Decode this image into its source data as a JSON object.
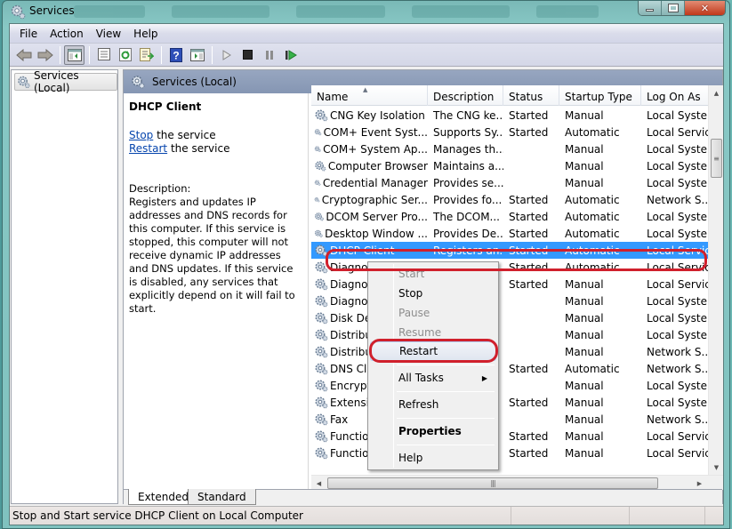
{
  "window": {
    "title": "Services",
    "buttons": {
      "minimize": "minimize",
      "maximize": "maximize",
      "close": "close"
    }
  },
  "menubar": {
    "items": [
      "File",
      "Action",
      "View",
      "Help"
    ]
  },
  "toolbar": {
    "buttons": [
      {
        "name": "back",
        "icon": "back-arrow-icon"
      },
      {
        "name": "forward",
        "icon": "forward-arrow-icon"
      },
      {
        "name": "show-hide-console-tree",
        "icon": "console-tree-icon"
      },
      {
        "name": "properties",
        "icon": "properties-icon"
      },
      {
        "name": "refresh",
        "icon": "refresh-icon"
      },
      {
        "name": "export-list",
        "icon": "export-icon"
      },
      {
        "name": "help",
        "icon": "help-icon"
      },
      {
        "name": "show-action-pane",
        "icon": "action-pane-icon"
      },
      {
        "name": "start-service",
        "icon": "play-icon"
      },
      {
        "name": "stop-service",
        "icon": "stop-icon"
      },
      {
        "name": "pause-service",
        "icon": "pause-icon"
      },
      {
        "name": "restart-service",
        "icon": "restart-icon"
      }
    ]
  },
  "tree": {
    "items": [
      {
        "label": "Services (Local)",
        "icon": "gear-icon",
        "selected": true
      }
    ]
  },
  "content": {
    "header_title": "Services (Local)",
    "details": {
      "service_name": "DHCP Client",
      "stop_link": "Stop",
      "stop_suffix": " the service",
      "restart_link": "Restart",
      "restart_suffix": " the service",
      "description_label": "Description:",
      "description": "Registers and updates IP addresses and DNS records for this computer. If this service is stopped, this computer will not receive dynamic IP addresses and DNS updates. If this service is disabled, any services that explicitly depend on it will fail to start."
    },
    "columns": [
      "Name",
      "Description",
      "Status",
      "Startup Type",
      "Log On As"
    ],
    "sort_column": "Name",
    "rows": [
      {
        "name": "CNG Key Isolation",
        "description": "The CNG ke...",
        "status": "Started",
        "startup": "Manual",
        "logon": "Local Syste..."
      },
      {
        "name": "COM+ Event Syst...",
        "description": "Supports Sy...",
        "status": "Started",
        "startup": "Automatic",
        "logon": "Local Service"
      },
      {
        "name": "COM+ System Ap...",
        "description": "Manages th...",
        "status": "",
        "startup": "Manual",
        "logon": "Local Syste..."
      },
      {
        "name": "Computer Browser",
        "description": "Maintains a...",
        "status": "",
        "startup": "Manual",
        "logon": "Local Syste..."
      },
      {
        "name": "Credential Manager",
        "description": "Provides se...",
        "status": "",
        "startup": "Manual",
        "logon": "Local Syste..."
      },
      {
        "name": "Cryptographic Ser...",
        "description": "Provides fo...",
        "status": "Started",
        "startup": "Automatic",
        "logon": "Network S..."
      },
      {
        "name": "DCOM Server Pro...",
        "description": "The DCOM...",
        "status": "Started",
        "startup": "Automatic",
        "logon": "Local Syste..."
      },
      {
        "name": "Desktop Window ...",
        "description": "Provides De...",
        "status": "Started",
        "startup": "Automatic",
        "logon": "Local Syste..."
      },
      {
        "name": "DHCP Client",
        "description": "Registers an...",
        "status": "Started",
        "startup": "Automatic",
        "logon": "Local Service",
        "selected": true
      },
      {
        "name": "Diagnos",
        "description": "",
        "status": "Started",
        "startup": "Automatic",
        "logon": "Local Service"
      },
      {
        "name": "Diagnos",
        "description": "",
        "status": "Started",
        "startup": "Manual",
        "logon": "Local Service"
      },
      {
        "name": "Diagnos",
        "description": "",
        "status": "",
        "startup": "Manual",
        "logon": "Local Syste..."
      },
      {
        "name": "Disk Def",
        "description": "",
        "status": "",
        "startup": "Manual",
        "logon": "Local Syste..."
      },
      {
        "name": "Distribut",
        "description": "",
        "status": "",
        "startup": "Manual",
        "logon": "Local Syste..."
      },
      {
        "name": "Distribut",
        "description": "",
        "status": "",
        "startup": "Manual",
        "logon": "Network S..."
      },
      {
        "name": "DNS Clie",
        "description": "",
        "status": "Started",
        "startup": "Automatic",
        "logon": "Network S..."
      },
      {
        "name": "Encrypti",
        "description": "",
        "status": "",
        "startup": "Manual",
        "logon": "Local Syste..."
      },
      {
        "name": "Extensib",
        "description": "",
        "status": "Started",
        "startup": "Manual",
        "logon": "Local Syste..."
      },
      {
        "name": "Fax",
        "description": "",
        "status": "",
        "startup": "Manual",
        "logon": "Network S..."
      },
      {
        "name": "Function",
        "description": "",
        "status": "Started",
        "startup": "Manual",
        "logon": "Local Service"
      },
      {
        "name": "Function",
        "description": "",
        "status": "Started",
        "startup": "Manual",
        "logon": "Local Service"
      }
    ],
    "tabs": [
      "Extended",
      "Standard"
    ],
    "active_tab": "Extended"
  },
  "context_menu": {
    "items": [
      {
        "label": "Start",
        "enabled": false
      },
      {
        "label": "Stop",
        "enabled": true
      },
      {
        "label": "Pause",
        "enabled": false
      },
      {
        "label": "Resume",
        "enabled": false
      },
      {
        "label": "Restart",
        "enabled": true,
        "highlighted": true
      },
      {
        "label": "All Tasks",
        "enabled": true,
        "submenu": true
      },
      {
        "label": "Refresh",
        "enabled": true
      },
      {
        "label": "Properties",
        "enabled": true,
        "bold": true
      },
      {
        "label": "Help",
        "enabled": true
      }
    ]
  },
  "statusbar": {
    "text": "Stop and Start service DHCP Client on Local Computer"
  },
  "colors": {
    "selection": "#3399ff",
    "annotation": "#d0202c",
    "link": "#0645ad",
    "header_band": "#8c9bb5"
  }
}
